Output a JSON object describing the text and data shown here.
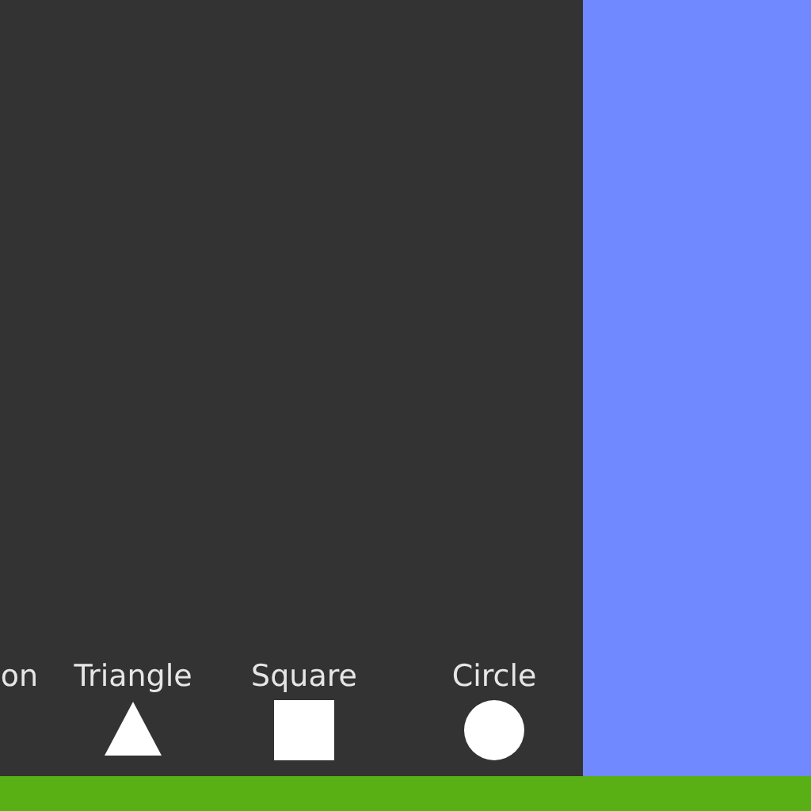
{
  "shape_palette": [
    {
      "label": "on"
    },
    {
      "label": "Triangle",
      "kind": "triangle"
    },
    {
      "label": "Square",
      "kind": "square"
    },
    {
      "label": "Circle",
      "kind": "circle"
    }
  ]
}
